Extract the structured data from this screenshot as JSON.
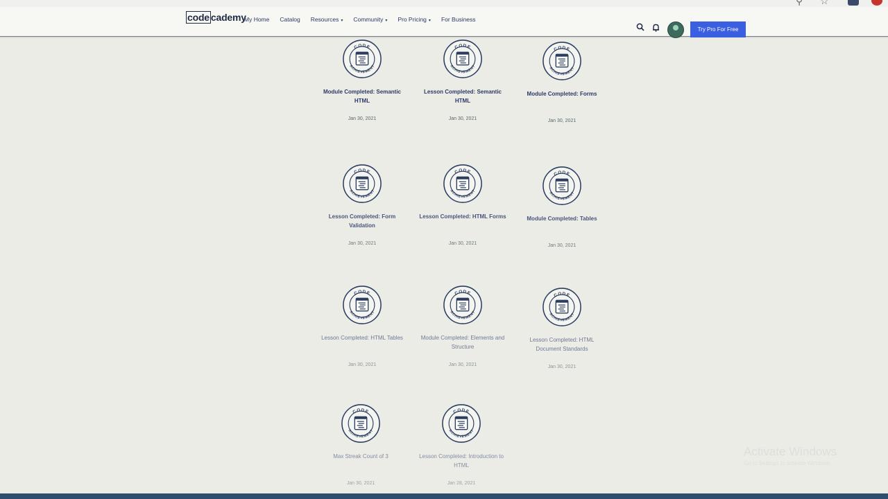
{
  "header": {
    "logo_boxed": "code",
    "logo_rest": "cademy",
    "nav": [
      {
        "label": "My Home",
        "caret": ""
      },
      {
        "label": "Catalog",
        "caret": ""
      },
      {
        "label": "Resources",
        "caret": "▾"
      },
      {
        "label": "Community",
        "caret": "▾"
      },
      {
        "label": "Pro Pricing",
        "caret": "▾"
      },
      {
        "label": "For Business",
        "caret": ""
      }
    ],
    "search_icon": "search-icon",
    "bell_icon": "bell-icon",
    "cta_label": "Try Pro For Free",
    "accent_color": "#3a5fe0"
  },
  "badges": [
    {
      "title": "Module Completed: Semantic HTML",
      "date": "Jan 30, 2021"
    },
    {
      "title": "Lesson Completed: Semantic HTML",
      "date": "Jan 30, 2021"
    },
    {
      "title": "Module Completed: Forms",
      "date": "Jan 30, 2021"
    },
    {
      "title": "Lesson Completed: Form Validation",
      "date": "Jan 30, 2021"
    },
    {
      "title": "Lesson Completed: HTML Forms",
      "date": "Jan 30, 2021"
    },
    {
      "title": "Module Completed: Tables",
      "date": "Jan 30, 2021"
    },
    {
      "title": "Lesson Completed: HTML Tables",
      "date": "Jan 30, 2021"
    },
    {
      "title": "Module Completed: Elements and Structure",
      "date": "Jan 30, 2021"
    },
    {
      "title": "Lesson Completed: HTML Document Standards",
      "date": "Jan 30, 2021"
    },
    {
      "title": "Max Streak Count of 3",
      "date": "Jan 30, 2021"
    },
    {
      "title": "Lesson Completed: Introduction to HTML",
      "date": "Jan 28, 2021"
    }
  ],
  "badge_ring_text_top": "CODE",
  "badge_ring_text_bottom": "ACHIEVEMENT",
  "watermark": {
    "title": "Activate Windows",
    "subtitle": "Go to Settings to activate Windows."
  }
}
